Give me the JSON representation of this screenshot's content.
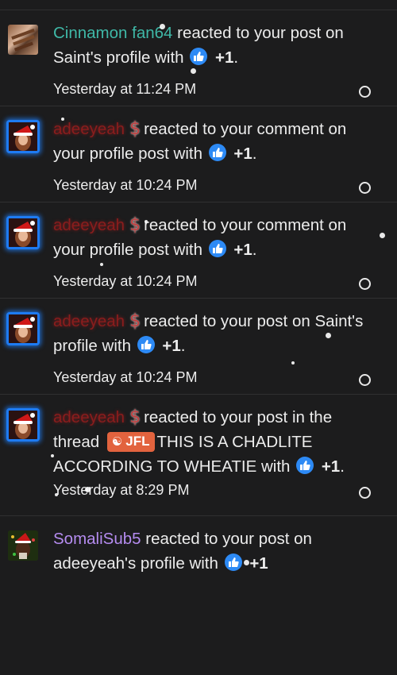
{
  "notifications": [
    {
      "user": "Cinnamon fan64",
      "text": "reacted to your post on Saint's profile with",
      "count": "+1",
      "time": "Yesterday at 11:24 PM"
    },
    {
      "user": "adeeyeah",
      "text": "reacted to your comment on your profile post with",
      "count": "+1",
      "time": "Yesterday at 10:24 PM"
    },
    {
      "user": "adeeyeah",
      "text": "reacted to your comment on your profile post with",
      "count": "+1",
      "time": "Yesterday at 10:24 PM"
    },
    {
      "user": "adeeyeah",
      "text": "reacted to your post on Saint's profile with",
      "count": "+1",
      "time": "Yesterday at 10:24 PM"
    },
    {
      "user": "adeeyeah",
      "text_before": "reacted to your post in the thread",
      "prefix_label": "JFL",
      "text_after": "THIS IS A CHADLITE ACCORDING TO WHEATIE with",
      "count": "+1",
      "time": "Yesterday at 8:29 PM"
    },
    {
      "user": "SomaliSub5",
      "text": "reacted to your post on adeeyeah's profile with",
      "count": "+1"
    }
  ],
  "colors": {
    "background": "#1c1c1d",
    "like": "#2d8af5",
    "prefix": "#e2633e",
    "avatar_glow": "#1e7bf2"
  },
  "icons": {
    "like": "thumbs-up-icon",
    "unread": "radio-circle-icon",
    "badge": "dollar-sign-icon"
  }
}
